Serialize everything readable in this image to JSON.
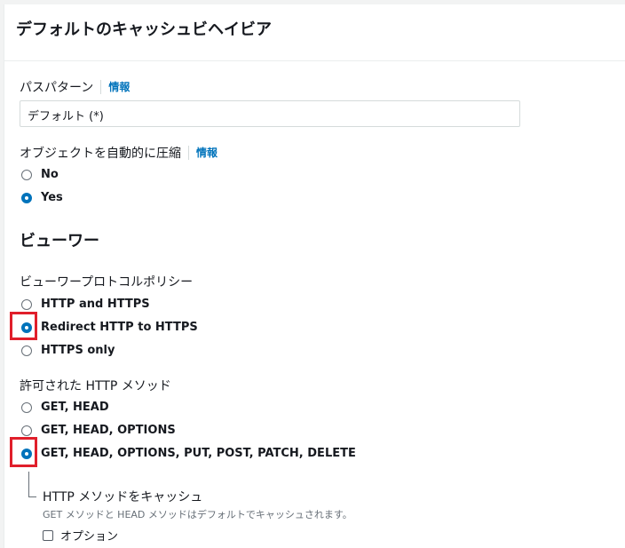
{
  "panel": {
    "title": "デフォルトのキャッシュビヘイビア"
  },
  "path_pattern": {
    "label": "パスパターン",
    "info": "情報",
    "value": "デフォルト (*)"
  },
  "compress": {
    "label": "オブジェクトを自動的に圧縮",
    "info": "情報",
    "options": [
      {
        "label": "No",
        "checked": false
      },
      {
        "label": "Yes",
        "checked": true
      }
    ]
  },
  "viewer": {
    "heading": "ビューワー",
    "protocol_policy": {
      "label": "ビューワープロトコルポリシー",
      "options": [
        {
          "label": "HTTP and HTTPS",
          "checked": false
        },
        {
          "label": "Redirect HTTP to HTTPS",
          "checked": true
        },
        {
          "label": "HTTPS only",
          "checked": false
        }
      ]
    },
    "allowed_methods": {
      "label": "許可された HTTP メソッド",
      "options": [
        {
          "label": "GET, HEAD",
          "checked": false
        },
        {
          "label": "GET, HEAD, OPTIONS",
          "checked": false
        },
        {
          "label": "GET, HEAD, OPTIONS, PUT, POST, PATCH, DELETE",
          "checked": true
        }
      ]
    },
    "cache_methods": {
      "label": "HTTP メソッドをキャッシュ",
      "description": "GET メソッドと HEAD メソッドはデフォルトでキャッシュされます。",
      "checkbox_label": "オプション",
      "checked": false
    }
  },
  "colors": {
    "accent": "#0073bb",
    "highlight": "#e01f2b"
  }
}
